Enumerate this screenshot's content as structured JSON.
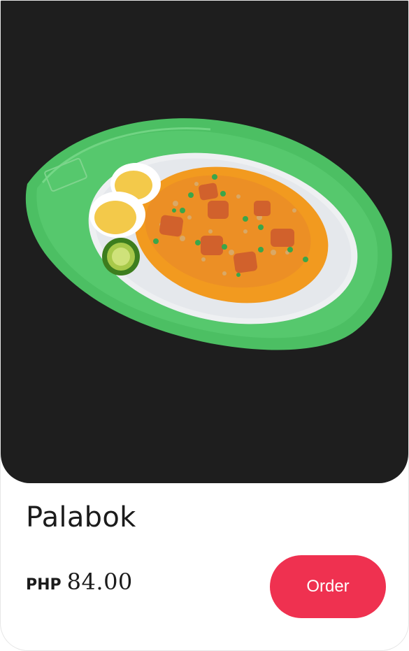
{
  "product": {
    "name": "Palabok",
    "currency": "PHP",
    "price": "84.00"
  },
  "actions": {
    "order_label": "Order"
  },
  "colors": {
    "image_background": "#1e1e1e",
    "order_button": "#ef3150",
    "plate": "#4cbf63",
    "sauce": "#f29a1f"
  }
}
